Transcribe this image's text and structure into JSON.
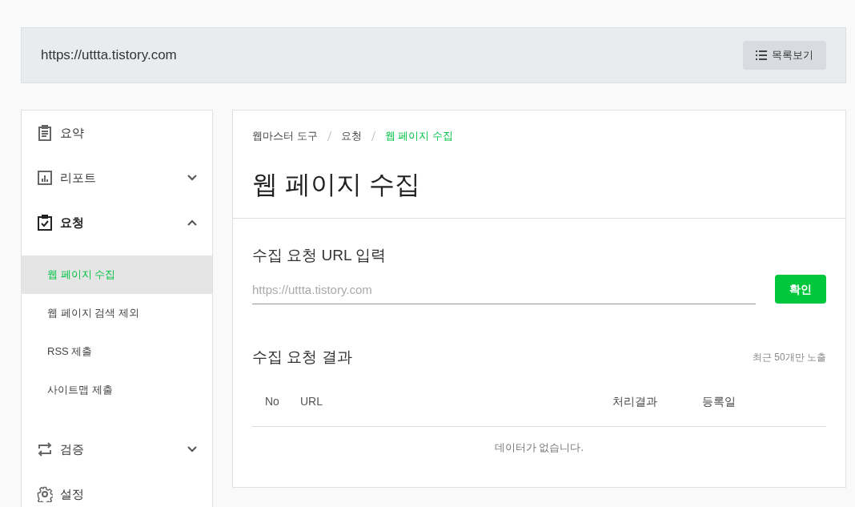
{
  "header": {
    "url": "https://uttta.tistory.com",
    "list_button": "목록보기"
  },
  "sidebar": {
    "items": [
      {
        "label": "요약"
      },
      {
        "label": "리포트",
        "expanded": false
      },
      {
        "label": "요청",
        "expanded": true,
        "children": [
          {
            "label": "웹 페이지 수집",
            "selected": true
          },
          {
            "label": "웹 페이지 검색 제외",
            "selected": false
          },
          {
            "label": "RSS 제출",
            "selected": false
          },
          {
            "label": "사이트맵 제출",
            "selected": false
          }
        ]
      },
      {
        "label": "검증",
        "expanded": false
      },
      {
        "label": "설정"
      }
    ]
  },
  "breadcrumb": [
    "웹마스터 도구",
    "요청",
    "웹 페이지 수집"
  ],
  "page_title": "웹 페이지 수집",
  "url_form": {
    "heading": "수집 요청 URL 입력",
    "placeholder": "https://uttta.tistory.com",
    "submit": "확인"
  },
  "results": {
    "heading": "수집 요청 결과",
    "note": "최근 50개만 노출",
    "table": {
      "columns": [
        "No",
        "URL",
        "처리결과",
        "등록일"
      ],
      "empty_message": "데이터가 없습니다."
    }
  }
}
